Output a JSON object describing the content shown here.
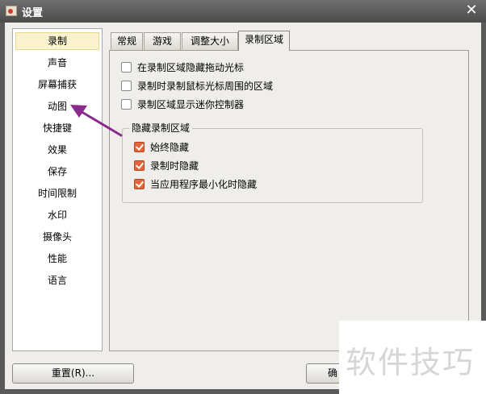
{
  "window": {
    "title": "设置"
  },
  "sidebar": {
    "items": [
      {
        "label": "录制",
        "selected": true
      },
      {
        "label": "声音"
      },
      {
        "label": "屏幕捕获"
      },
      {
        "label": "动图"
      },
      {
        "label": "快捷键"
      },
      {
        "label": "效果"
      },
      {
        "label": "保存"
      },
      {
        "label": "时间限制"
      },
      {
        "label": "水印"
      },
      {
        "label": "摄像头"
      },
      {
        "label": "性能"
      },
      {
        "label": "语言"
      }
    ]
  },
  "tabs": [
    {
      "label": "常规"
    },
    {
      "label": "游戏"
    },
    {
      "label": "调整大小"
    },
    {
      "label": "录制区域",
      "active": true
    }
  ],
  "panel": {
    "options": [
      {
        "label": "在录制区域隐藏拖动光标",
        "checked": false
      },
      {
        "label": "录制时录制鼠标光标周围的区域",
        "checked": false
      },
      {
        "label": "录制区域显示迷你控制器",
        "checked": false
      }
    ],
    "hide_group": {
      "title": "隐藏录制区域",
      "options": [
        {
          "label": "始终隐藏",
          "checked": true
        },
        {
          "label": "录制时隐藏",
          "checked": true
        },
        {
          "label": "当应用程序最小化时隐藏",
          "checked": true
        }
      ]
    }
  },
  "footer": {
    "reset_label": "重置(R)...",
    "ok_label": "确"
  },
  "watermark": {
    "text": "软件技巧"
  },
  "colors": {
    "accent_check": "#e7643a",
    "annotation_arrow": "#8b2a8e",
    "selected_item": "#fbf3cf"
  }
}
